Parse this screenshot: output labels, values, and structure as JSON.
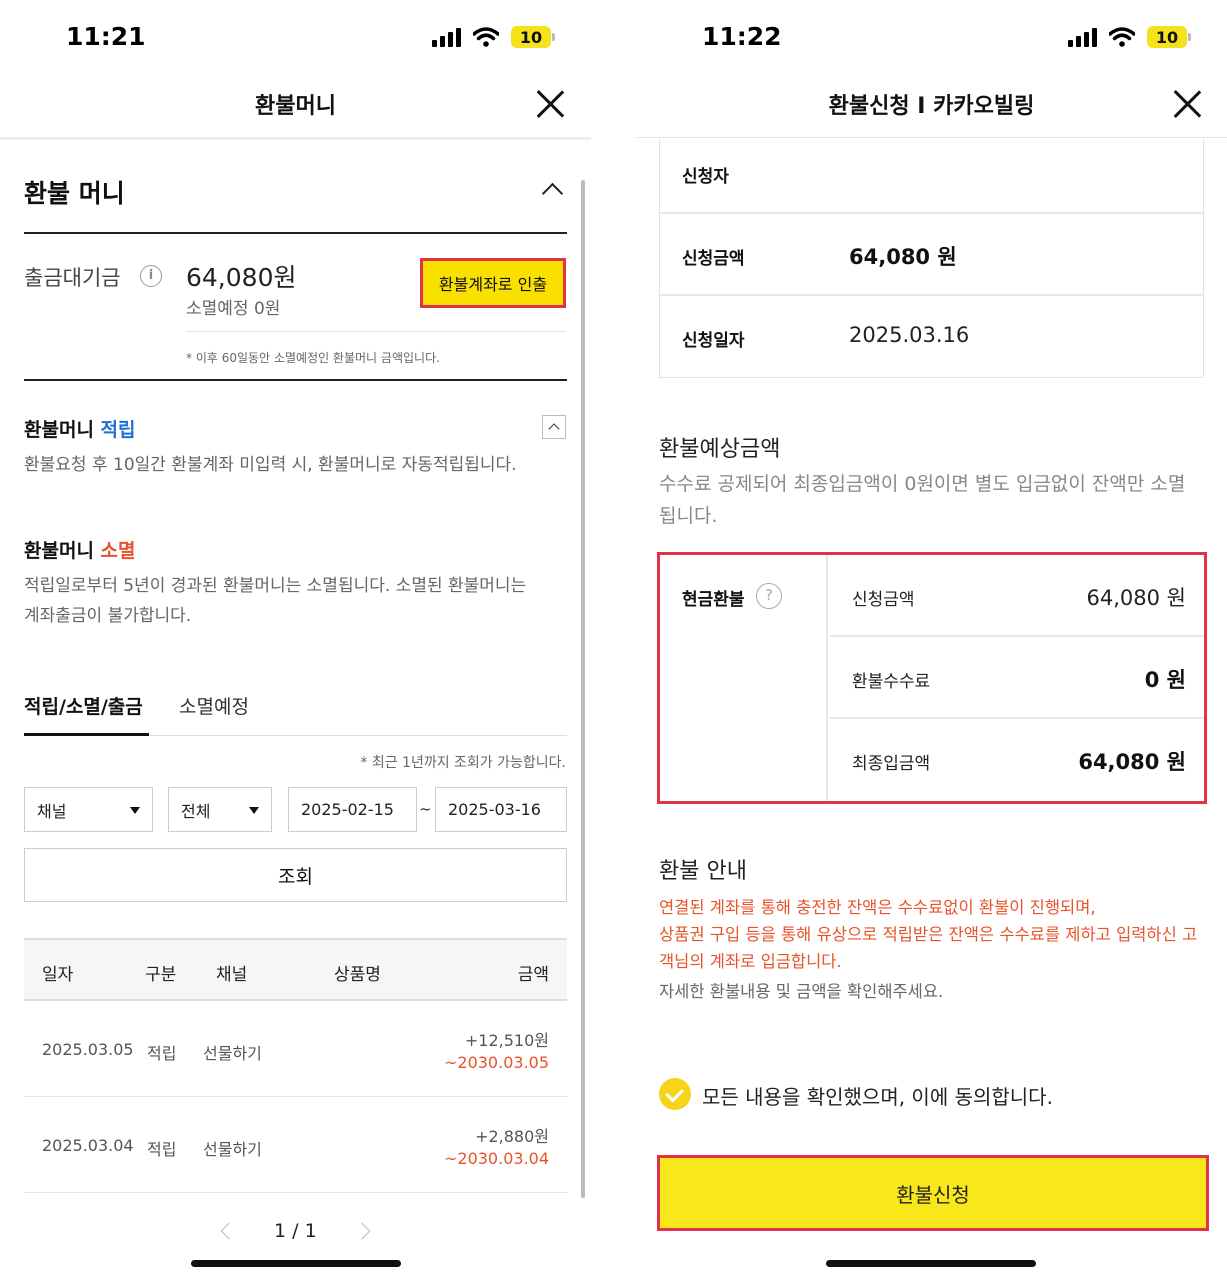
{
  "left": {
    "status": {
      "time": "11:21",
      "battery": "10"
    },
    "header": {
      "title": "환불머니"
    },
    "section": {
      "title": "환불 머니"
    },
    "pending": {
      "label": "출금대기금",
      "amount": "64,080원",
      "expire": "소멸예정 0원",
      "withdraw_button": "환불계좌로 인출",
      "note": "* 이후 60일동안 소멸예정인 환불머니 금액입니다."
    },
    "accrual": {
      "title_prefix": "환불머니 ",
      "title_highlight": "적립",
      "desc": "환불요청 후 10일간 환불계좌 미입력 시, 환불머니로 자동적립됩니다."
    },
    "expiry": {
      "title_prefix": "환불머니 ",
      "title_highlight": "소멸",
      "desc": "적립일로부터 5년이 경과된 환불머니는 소멸됩니다. 소멸된 환불머니는 계좌출금이 불가합니다."
    },
    "tabs": [
      "적립/소멸/출금",
      "소멸예정"
    ],
    "query_note": "* 최근 1년까지 조회가 가능합니다.",
    "filters": {
      "channel": "채널",
      "type": "전체",
      "date_from": "2025-02-15",
      "tilde": "~",
      "date_to": "2025-03-16",
      "query_button": "조회"
    },
    "table": {
      "headers": [
        "일자",
        "구분",
        "채널",
        "상품명",
        "금액"
      ],
      "rows": [
        {
          "date": "2025.03.05",
          "type": "적립",
          "channel": "선물하기",
          "product": "",
          "amount": "+12,510원",
          "expire": "~2030.03.05"
        },
        {
          "date": "2025.03.04",
          "type": "적립",
          "channel": "선물하기",
          "product": "",
          "amount": "+2,880원",
          "expire": "~2030.03.04"
        }
      ]
    },
    "pagination": {
      "text": "1 / 1"
    }
  },
  "right": {
    "status": {
      "time": "11:22",
      "battery": "10"
    },
    "header": {
      "title": "환불신청 I 카카오빌링"
    },
    "info": {
      "applicant_label": "신청자",
      "applicant_value": "",
      "amount_label": "신청금액",
      "amount_value": "64,080 원",
      "date_label": "신청일자",
      "date_value": "2025.03.16"
    },
    "estimate": {
      "title": "환불예상금액",
      "desc": "수수료 공제되어 최종입금액이 0원이면 별도 입금없이 잔액만 소멸됩니다."
    },
    "refund": {
      "label": "현금환불",
      "rows": [
        {
          "label": "신청금액",
          "value": "64,080 원"
        },
        {
          "label": "환불수수료",
          "value": "0 원"
        },
        {
          "label": "최종입금액",
          "value": "64,080 원"
        }
      ]
    },
    "guide": {
      "title": "환불 안내",
      "line1": "연결된 계좌를 통해 충전한 잔액은 수수료없이 환불이 진행되며,",
      "line2": "상품권 구입 등을 통해 유상으로 적립받은 잔액은 수수료를 제하고 입력하신 고객님의 계좌로 입금합니다.",
      "line3": "자세한 환불내용 및 금액을 확인해주세요."
    },
    "agree": {
      "text": "모든 내용을 확인했으며, 이에 동의합니다."
    },
    "submit_button": "환불신청"
  },
  "colors": {
    "accent_yellow": "#f9e000",
    "highlight_red": "#e0334a",
    "warning_orange": "#e8532b",
    "link_blue": "#1f6fd1"
  }
}
